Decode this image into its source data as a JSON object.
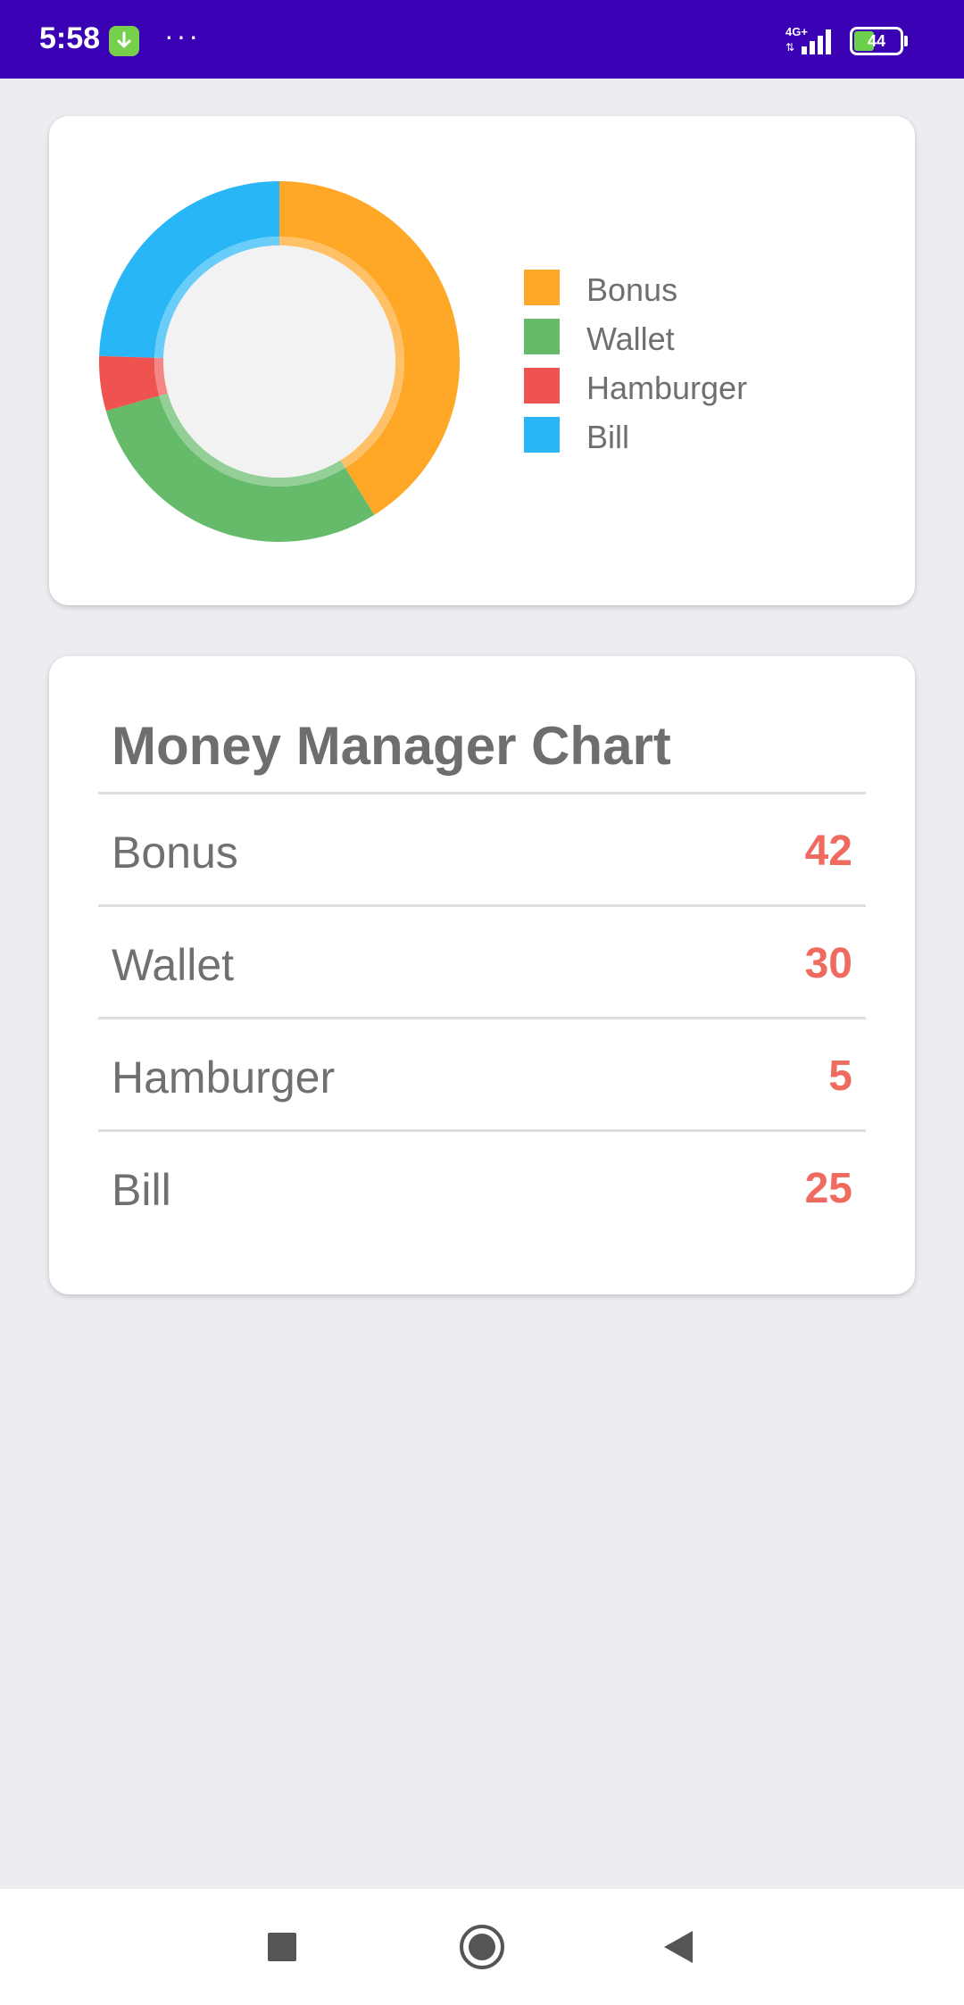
{
  "status_bar": {
    "time": "5:58",
    "dots": "···",
    "network": "4G+",
    "battery": "44",
    "icons": [
      "download-icon",
      "signal-icon",
      "battery-icon"
    ]
  },
  "chart_data": {
    "type": "pie",
    "categories": [
      "Bonus",
      "Wallet",
      "Hamburger",
      "Bill"
    ],
    "values": [
      42,
      30,
      5,
      25
    ],
    "colors": [
      "#ffa726",
      "#66bb6a",
      "#ef5350",
      "#29b6f6"
    ],
    "donut": true,
    "legend_position": "right"
  },
  "table": {
    "title": "Money Manager Chart",
    "rows": [
      {
        "label": "Bonus",
        "value": "42"
      },
      {
        "label": "Wallet",
        "value": "30"
      },
      {
        "label": "Hamburger",
        "value": "5"
      },
      {
        "label": "Bill",
        "value": "25"
      }
    ]
  },
  "nav_bar": {
    "icons": [
      "recents-square-icon",
      "home-circle-icon",
      "back-triangle-icon"
    ]
  }
}
